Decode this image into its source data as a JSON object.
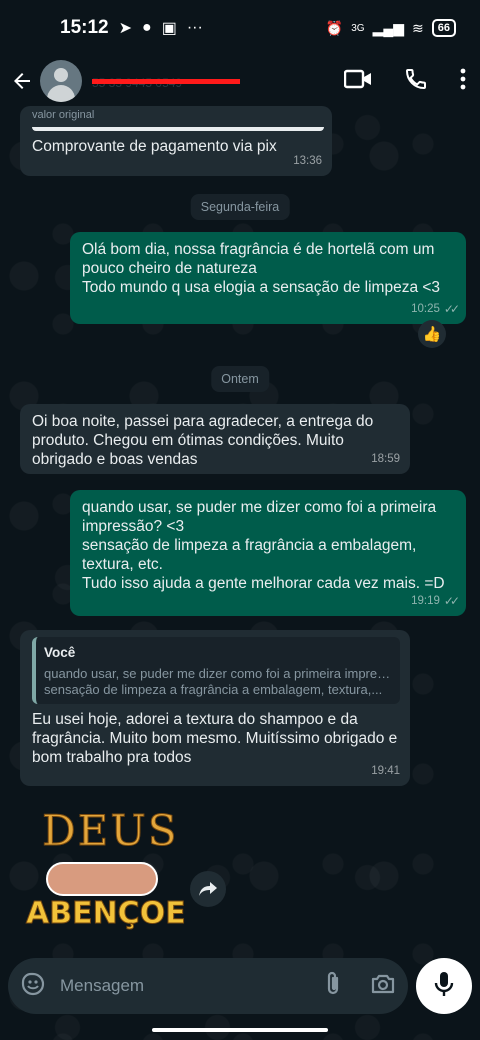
{
  "status_bar": {
    "time": "15:12",
    "battery": "66",
    "network": "3G"
  },
  "header": {
    "contact_name": "55 35 9445 0549",
    "icons": [
      "back-arrow-icon",
      "video-call-icon",
      "phone-icon",
      "more-icon"
    ]
  },
  "messages": [
    {
      "direction": "in",
      "reply_snippet": "valor original",
      "text": "Comprovante de pagamento via pix",
      "time": "13:36"
    },
    {
      "direction": "out",
      "text": "Olá bom dia, nossa fragrância é de hortelã com um pouco cheiro de natureza\nTodo mundo q usa elogia a sensação de limpeza <3",
      "time": "10:25",
      "reaction": "👍"
    },
    {
      "direction": "in",
      "text": "Oi boa noite, passei para agradecer, a entrega do produto. Chegou em ótimas condições. Muito obrigado e boas vendas",
      "time": "18:59"
    },
    {
      "direction": "out",
      "text": "quando usar, se puder me dizer como foi a primeira impressão? <3\nsensação de limpeza a fragrância a embalagem, textura, etc.\nTudo isso ajuda a gente melhorar cada vez mais. =D",
      "time": "19:19"
    },
    {
      "direction": "in",
      "quote": {
        "author": "Você",
        "line1": "quando usar, se puder me dizer como foi a primeira impressão? <3",
        "line2": "sensação de limpeza a fragrância a embalagem, textura,..."
      },
      "text": "Eu usei hoje, adorei a textura do shampoo e da fragrância. Muito bom mesmo. Muitíssimo obrigado e bom trabalho pra todos",
      "time": "19:41"
    }
  ],
  "date_separators": [
    "Segunda-feira",
    "Ontem"
  ],
  "sticker": {
    "line1": "DEUS",
    "line2": "ABENÇOE"
  },
  "composer": {
    "placeholder": "Mensagem"
  },
  "colors": {
    "background": "#0b141a",
    "incoming": "#202c33",
    "outgoing": "#005c4b",
    "redaction": "#ff1a1a"
  }
}
